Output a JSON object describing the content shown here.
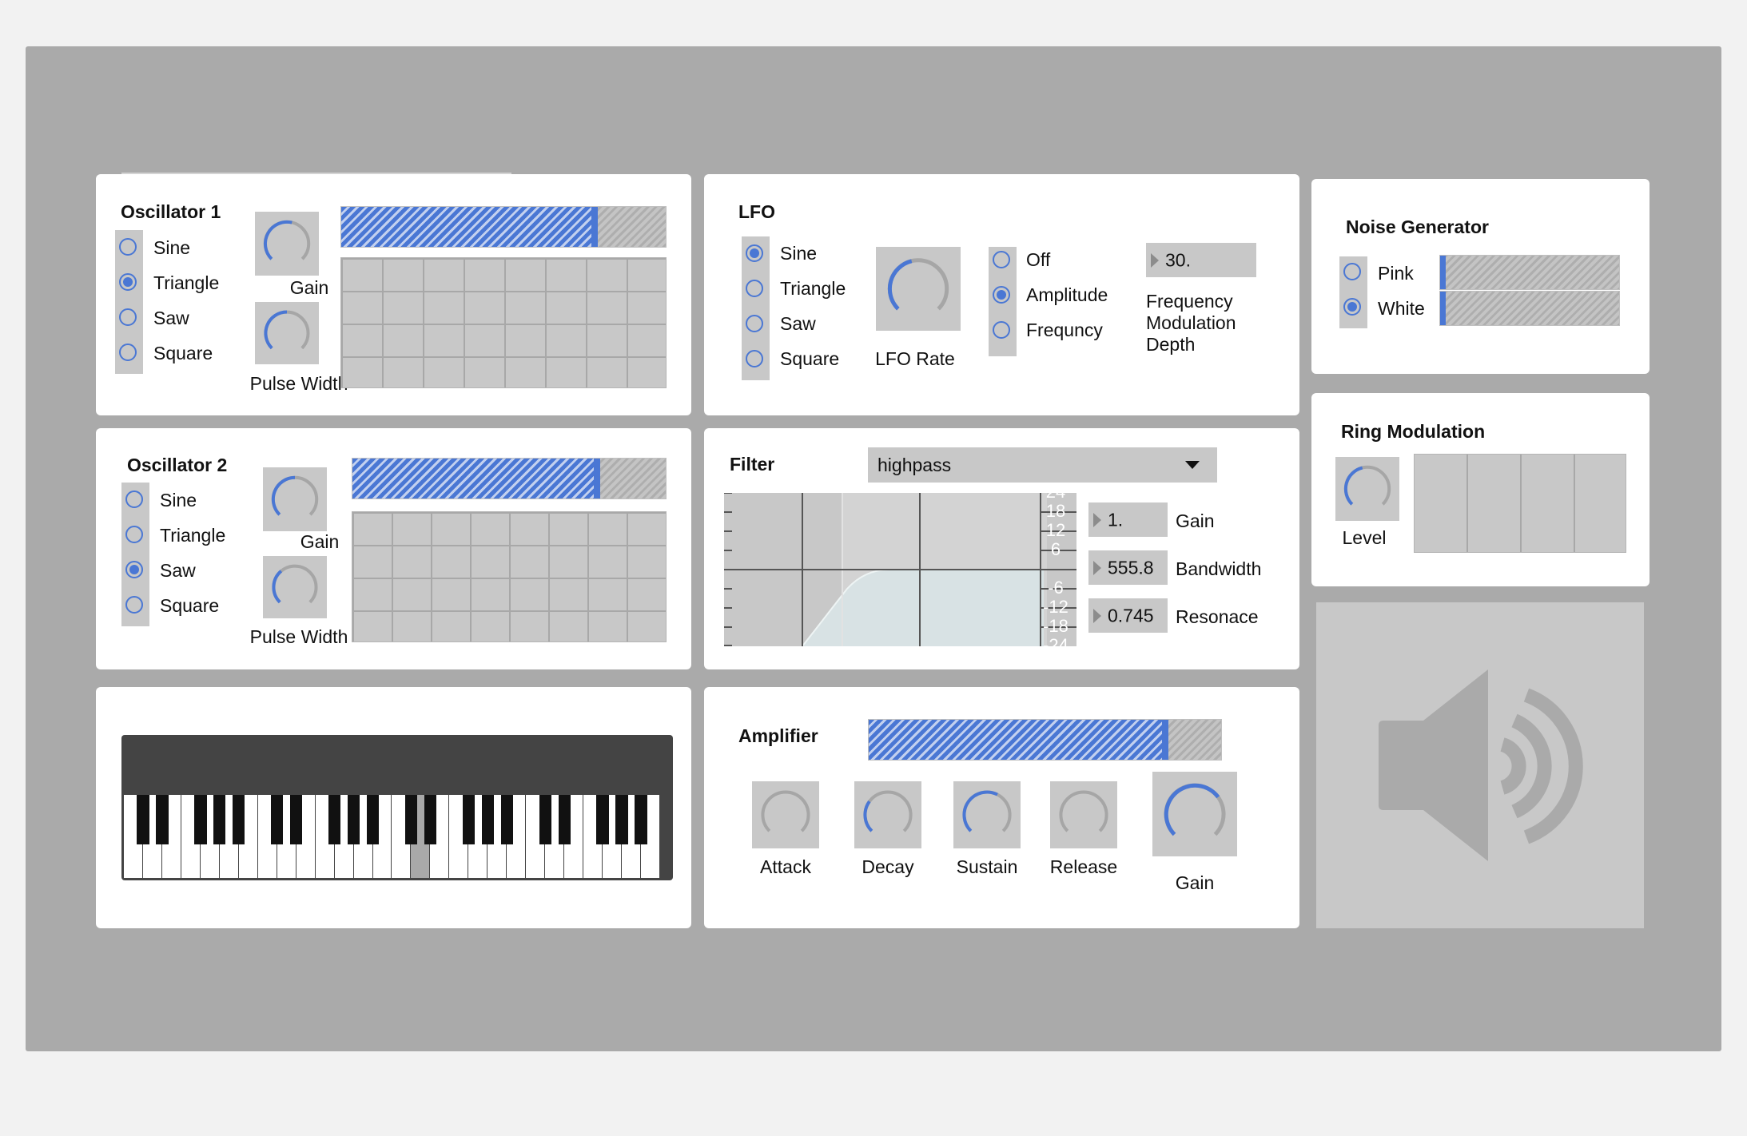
{
  "colors": {
    "accent": "#4a77d4",
    "background": "#aaaaaa",
    "panel": "#ffffff",
    "control": "#c8c8c8"
  },
  "sequencer": {
    "steps": 12,
    "active_step": 1
  },
  "osc1": {
    "title": "Oscillator 1",
    "waveforms": [
      {
        "label": "Sine"
      },
      {
        "label": "Triangle"
      },
      {
        "label": "Saw"
      },
      {
        "label": "Square"
      }
    ],
    "selected": "Triangle",
    "gain_label": "Gain",
    "gain_level": 0.55,
    "pulse_label": "Pulse Width",
    "pulse_level": 0.5,
    "level_fill": 0.79
  },
  "osc2": {
    "title": "Oscillator 2",
    "waveforms": [
      {
        "label": "Sine"
      },
      {
        "label": "Triangle"
      },
      {
        "label": "Saw"
      },
      {
        "label": "Square"
      }
    ],
    "selected": "Saw",
    "gain_label": "Gain",
    "gain_level": 0.5,
    "pulse_label": "Pulse Width",
    "pulse_level": 0.35,
    "level_fill": 0.79
  },
  "lfo": {
    "title": "LFO",
    "waveforms": [
      {
        "label": "Sine"
      },
      {
        "label": "Triangle"
      },
      {
        "label": "Saw"
      },
      {
        "label": "Square"
      }
    ],
    "selected": "Sine",
    "rate_label": "LFO Rate",
    "rate_level": 0.45,
    "targets": [
      {
        "label": "Off"
      },
      {
        "label": "Amplitude"
      },
      {
        "label": "Frequncy"
      }
    ],
    "target_selected": "Amplitude",
    "depth_value": "30.",
    "depth_label_lines": [
      "Frequency",
      "Modulation",
      "Depth"
    ]
  },
  "noise": {
    "title": "Noise Generator",
    "types": [
      {
        "label": "Pink"
      },
      {
        "label": "White"
      }
    ],
    "selected": "White"
  },
  "ring": {
    "title": "Ring Modulation",
    "level_label": "Level",
    "level": 0.45
  },
  "filter": {
    "title": "Filter",
    "type": "highpass",
    "gain_value": "1.",
    "gain_label": "Gain",
    "bandwidth_value": "555.8",
    "bandwidth_label": "Bandwidth",
    "resonance_value": "0.745",
    "resonance_label": "Resonace",
    "db_labels_top": [
      "24",
      "18",
      "12",
      "6"
    ],
    "db_labels_bottom": [
      "-6",
      "-12",
      "-18",
      "-24"
    ]
  },
  "amplifier": {
    "title": "Amplifier",
    "level_fill": 0.85,
    "knobs": [
      {
        "label": "Attack",
        "level": 0.0
      },
      {
        "label": "Decay",
        "level": 0.3
      },
      {
        "label": "Sustain",
        "level": 0.6
      },
      {
        "label": "Release",
        "level": 0.0
      },
      {
        "label": "Gain",
        "level": 0.7
      }
    ]
  },
  "keyboard": {
    "white_keys": 28,
    "pressed_white_key": 15
  }
}
